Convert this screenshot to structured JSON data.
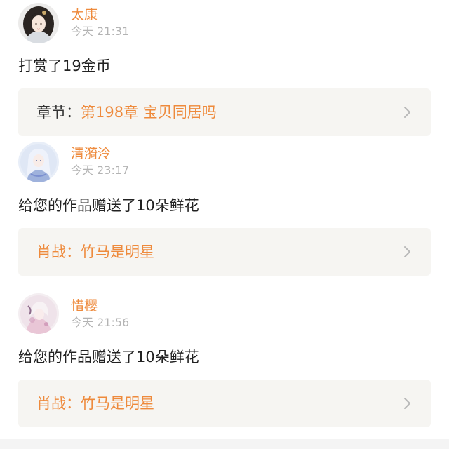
{
  "colors": {
    "accent": "#ee8a3c",
    "timestamp": "#b3b3b3",
    "card_background": "#f6f5f2"
  },
  "feed": [
    {
      "username": "太康",
      "time": "今天 21:31",
      "message": "打赏了19金币",
      "card": {
        "prefix": "章节：",
        "title": "第198章 宝贝同居吗"
      }
    },
    {
      "username": "清漪泠",
      "time": "今天 23:17",
      "message": "给您的作品赠送了10朵鲜花",
      "card": {
        "prefix": "肖战：",
        "title": "竹马是明星"
      }
    },
    {
      "username": "惜樱",
      "time": "今天 21:56",
      "message": "给您的作品赠送了10朵鲜花",
      "card": {
        "prefix": "肖战：",
        "title": "竹马是明星"
      }
    }
  ]
}
